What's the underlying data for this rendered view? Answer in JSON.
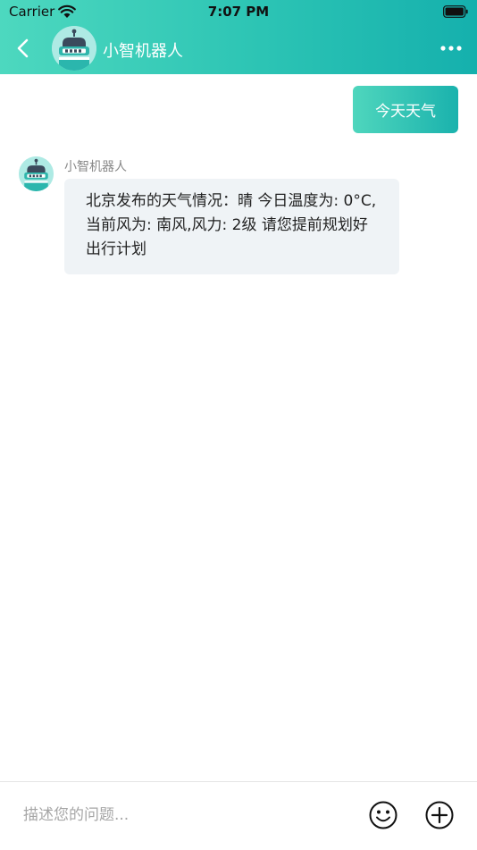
{
  "status_bar": {
    "carrier": "Carrier",
    "time": "7:07 PM"
  },
  "nav": {
    "title": "小智机器人",
    "back_icon": "chevron-left-icon",
    "more_icon": "more-horizontal-icon"
  },
  "messages": [
    {
      "direction": "outgoing",
      "text": "今天天气"
    },
    {
      "direction": "incoming",
      "sender": "小智机器人",
      "text": "北京发布的天气情况：晴 今日温度为: 0°C,当前风为: 南风,风力: 2级 请您提前规划好出行计划"
    }
  ],
  "input": {
    "placeholder": "描述您的问题...",
    "value": "",
    "emoji_icon": "smiley-icon",
    "plus_icon": "plus-circle-icon"
  },
  "colors": {
    "accent_start": "#4dd8bf",
    "accent_end": "#15b0ad",
    "bubble_in": "#eff3f6"
  }
}
